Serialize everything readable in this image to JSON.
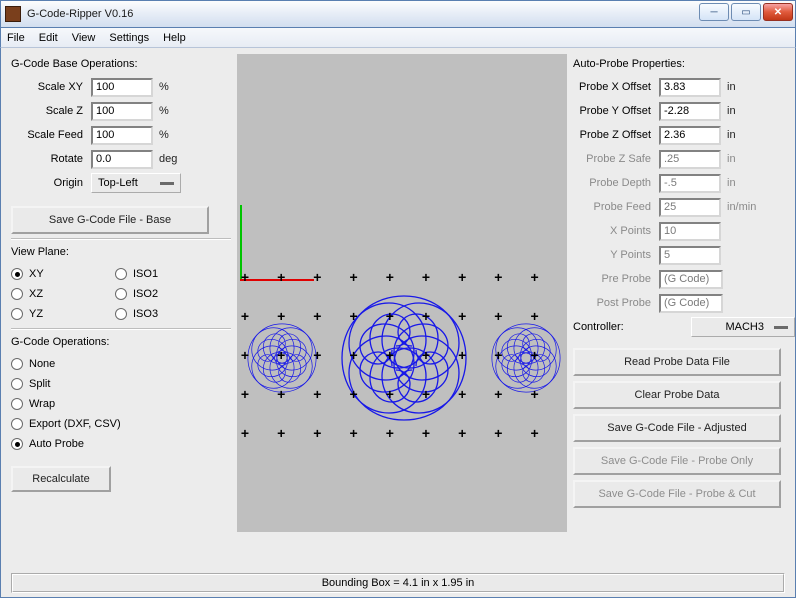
{
  "window": {
    "title": "G-Code-Ripper V0.16"
  },
  "menu": {
    "file": "File",
    "edit": "Edit",
    "view": "View",
    "settings": "Settings",
    "help": "Help"
  },
  "base": {
    "title": "G-Code Base Operations:",
    "scalexy": {
      "label": "Scale XY",
      "value": "100",
      "unit": "%"
    },
    "scalez": {
      "label": "Scale Z",
      "value": "100",
      "unit": "%"
    },
    "scalefeed": {
      "label": "Scale Feed",
      "value": "100",
      "unit": "%"
    },
    "rotate": {
      "label": "Rotate",
      "value": "0.0",
      "unit": "deg"
    },
    "origin": {
      "label": "Origin",
      "value": "Top-Left"
    },
    "savebtn": "Save G-Code File - Base"
  },
  "viewplane": {
    "title": "View Plane:",
    "xy": "XY",
    "xz": "XZ",
    "yz": "YZ",
    "iso1": "ISO1",
    "iso2": "ISO2",
    "iso3": "ISO3",
    "selected": "XY"
  },
  "ops": {
    "title": "G-Code Operations:",
    "none": "None",
    "split": "Split",
    "wrap": "Wrap",
    "export": "Export (DXF, CSV)",
    "auto": "Auto Probe",
    "selected": "Auto Probe",
    "recalc": "Recalculate"
  },
  "probe": {
    "title": "Auto-Probe Properties:",
    "xoff": {
      "label": "Probe X Offset",
      "value": "3.83",
      "unit": "in"
    },
    "yoff": {
      "label": "Probe Y Offset",
      "value": "-2.28",
      "unit": "in"
    },
    "zoff": {
      "label": "Probe Z Offset",
      "value": "2.36",
      "unit": "in"
    },
    "zsafe": {
      "label": "Probe Z Safe",
      "value": ".25",
      "unit": "in"
    },
    "depth": {
      "label": "Probe Depth",
      "value": "-.5",
      "unit": "in"
    },
    "feed": {
      "label": "Probe Feed",
      "value": "25",
      "unit": "in/min"
    },
    "xpts": {
      "label": "X Points",
      "value": "10"
    },
    "ypts": {
      "label": "Y Points",
      "value": "5"
    },
    "pre": {
      "label": "Pre Probe",
      "value": "(G Code)"
    },
    "post": {
      "label": "Post Probe",
      "value": "(G Code)"
    },
    "controller": {
      "label": "Controller:",
      "value": "MACH3"
    },
    "buttons": {
      "read": "Read Probe Data File",
      "clear": "Clear Probe Data",
      "adj": "Save G-Code File - Adjusted",
      "ponly": "Save G-Code File - Probe Only",
      "pcut": "Save G-Code File - Probe & Cut"
    }
  },
  "status": {
    "text": "Bounding Box = 4.1 in  x 1.95 in"
  }
}
